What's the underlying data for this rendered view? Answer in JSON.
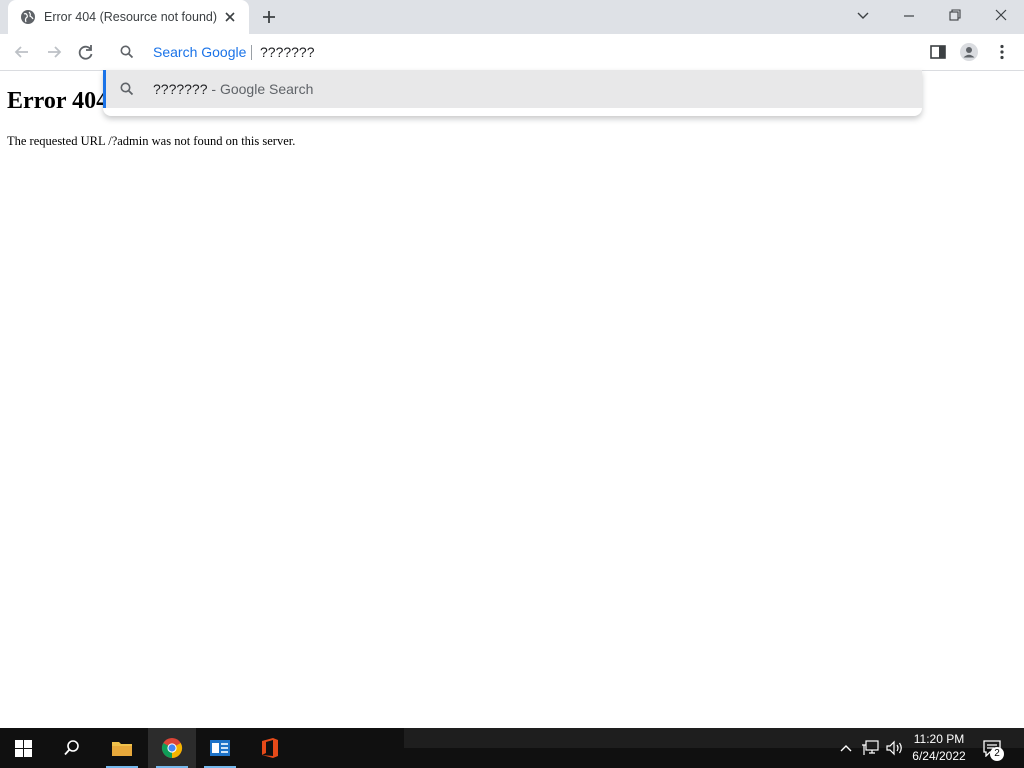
{
  "browser": {
    "tab": {
      "title": "Error 404 (Resource not found)",
      "favicon": "globe-icon"
    },
    "omnibox": {
      "prefix": "Search Google",
      "text": "???????"
    },
    "suggestion": {
      "query": "???????",
      "suffix": " - Google Search"
    },
    "colors": {
      "tabstrip": "#dee1e6",
      "accent": "#1a73e8"
    }
  },
  "page": {
    "heading": "Error 404",
    "message": "The requested URL /?admin was not found on this server."
  },
  "taskbar": {
    "apps": [
      "start-icon",
      "search-icon",
      "file-explorer-icon",
      "chrome-icon",
      "app-icon",
      "office-icon"
    ],
    "clock": {
      "time": "11:20 PM",
      "date": "6/24/2022"
    },
    "notification_count": "2"
  }
}
